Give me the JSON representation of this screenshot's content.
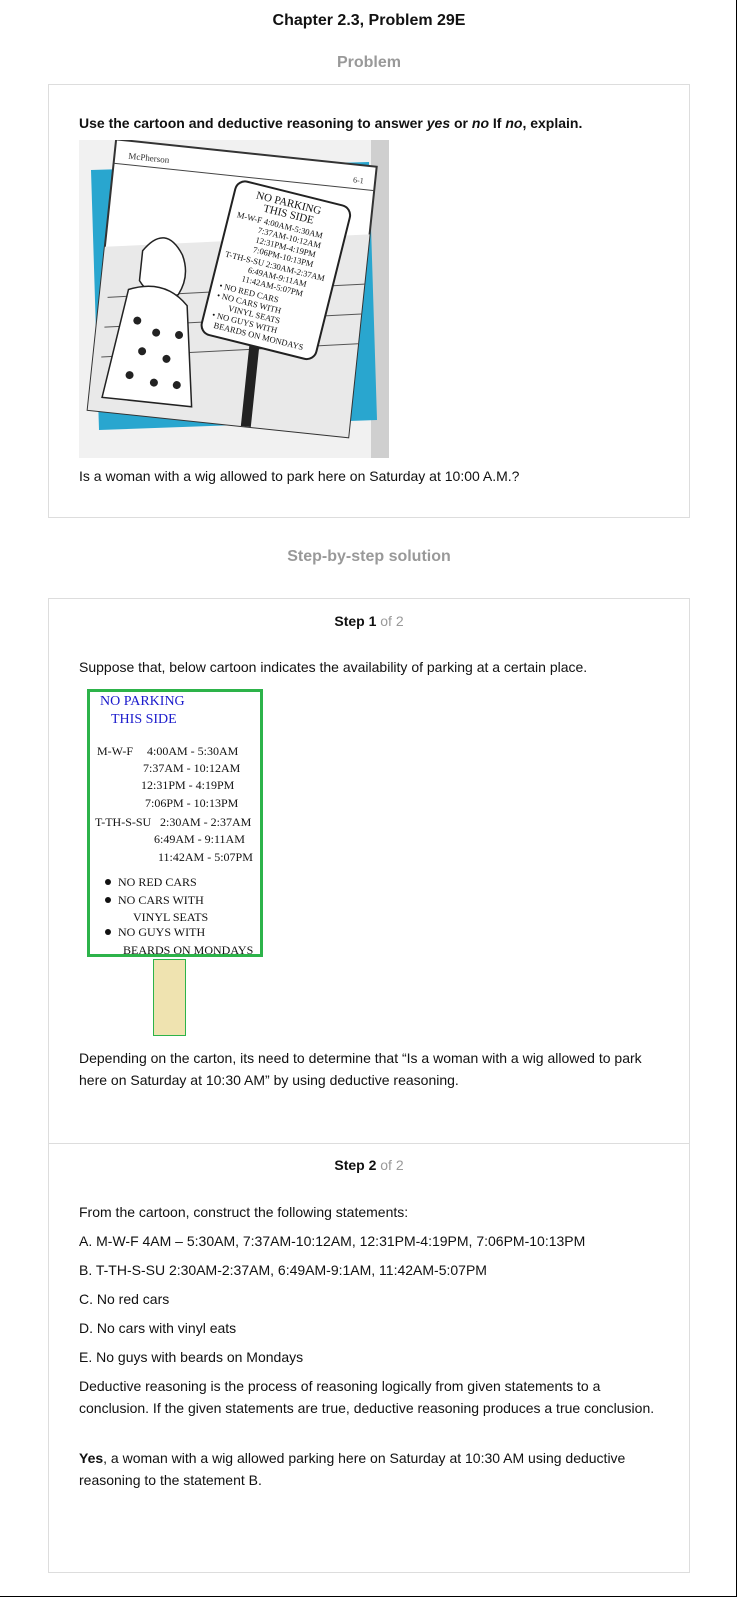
{
  "title": "Chapter 2.3, Problem 29E",
  "problem_heading": "Problem",
  "problem": {
    "prompt_start": "Use the cartoon and deductive reasoning to answer ",
    "prompt_yes": "yes",
    "prompt_or": " or ",
    "prompt_no": "no",
    "prompt_if": " If ",
    "prompt_no2": "no",
    "prompt_end": ", explain.",
    "question": "Is a woman with a wig allowed to park here on Saturday at 10:00 A.M.?",
    "cartoon_sign": {
      "brand": "McPherson",
      "corner": "6-1",
      "lines": [
        "NO PARKING",
        "THIS SIDE",
        "M-W-F 4:00AM-5:30AM",
        "7:37AM-10:12AM",
        "12:31PM-4:19PM",
        "7:06PM-10:13PM",
        "T-TH-S-SU 2:30AM-2:37AM",
        "6:49AM-9:11AM",
        "11:42AM-5:07PM",
        "• NO RED CARS",
        "• NO CARS WITH",
        "VINYL SEATS",
        "• NO GUYS WITH",
        "BEARDS ON MONDAYS"
      ]
    }
  },
  "solution_heading": "Step-by-step solution",
  "step1": {
    "label": "Step 1",
    "of": "of 2",
    "intro": "Suppose that, below cartoon indicates the availability of parking at a certain place.",
    "sign": {
      "head1": "NO PARKING",
      "head2": "THIS SIDE",
      "mwf_label": "M-W-F",
      "mwf": [
        "4:00AM - 5:30AM",
        "7:37AM - 10:12AM",
        "12:31PM - 4:19PM",
        "7:06PM - 10:13PM"
      ],
      "tth_label": "T-TH-S-SU",
      "tth": [
        "2:30AM - 2:37AM",
        "6:49AM - 9:11AM",
        "11:42AM - 5:07PM"
      ],
      "rule1": "NO RED CARS",
      "rule2a": "NO CARS WITH",
      "rule2b": "VINYL SEATS",
      "rule3a": "NO GUYS WITH",
      "rule3b": "BEARDS ON MONDAYS"
    },
    "outro": "Depending on the carton, its need to determine that “Is a woman with a wig allowed to park here on Saturday at 10:30 AM” by using deductive reasoning."
  },
  "step2": {
    "label": "Step 2",
    "of": "of 2",
    "intro": "From the cartoon, construct the following statements:",
    "statements": [
      "A. M-W-F 4AM – 5:30AM, 7:37AM-10:12AM, 12:31PM-4:19PM, 7:06PM-10:13PM",
      "B. T-TH-S-SU 2:30AM-2:37AM, 6:49AM-9:1AM, 11:42AM-5:07PM",
      "C. No red cars",
      "D. No cars with vinyl eats",
      "E. No guys with beards on Mondays"
    ],
    "definition": "Deductive reasoning is the process of reasoning logically from given statements to a conclusion. If the given statements are true, deductive reasoning produces a true conclusion.",
    "answer_bold": "Yes",
    "answer_rest": ", a woman with a wig allowed parking here on Saturday at 10:30 AM using deductive reasoning to the statement B."
  }
}
